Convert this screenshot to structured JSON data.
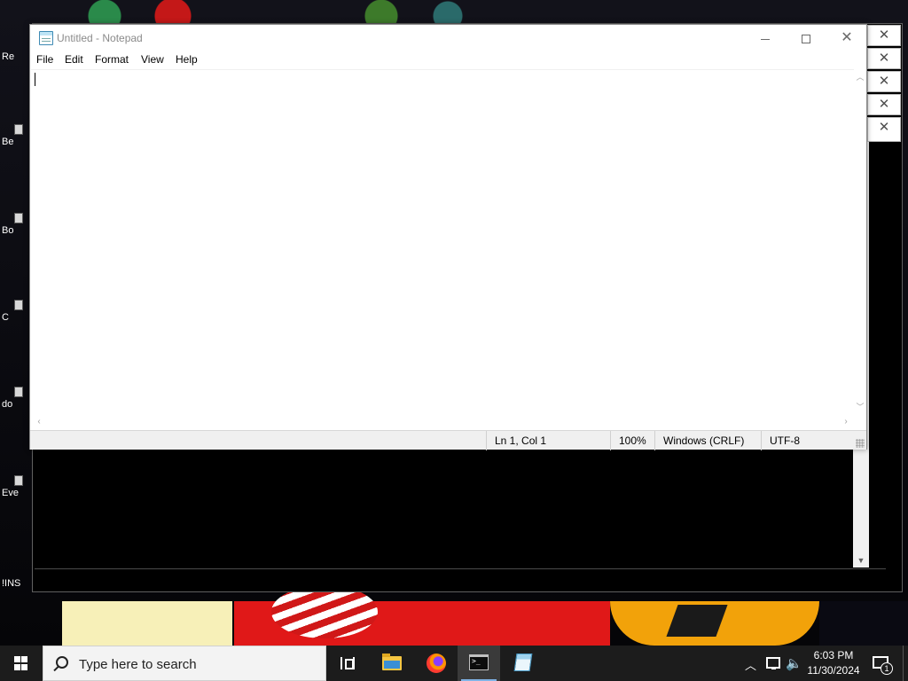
{
  "notepad": {
    "title": "Untitled - Notepad",
    "menu": [
      "File",
      "Edit",
      "Format",
      "View",
      "Help"
    ],
    "content": "",
    "status": {
      "position": "Ln 1, Col 1",
      "zoom": "100%",
      "line_ending": "Windows (CRLF)",
      "encoding": "UTF-8"
    }
  },
  "desktop": {
    "icons": [
      "Re",
      "Be",
      "Bo",
      "C",
      "do",
      "Eve",
      "!INS"
    ]
  },
  "taskbar": {
    "search_placeholder": "Type here to search",
    "apps": [
      "task-view",
      "file-explorer",
      "firefox",
      "command-prompt",
      "notepad"
    ],
    "active_app": "command-prompt",
    "clock_time": "6:03 PM",
    "clock_date": "11/30/2024",
    "notification_count": "1"
  },
  "colors": {
    "taskbar_bg": "#1c1c1c",
    "notepad_bg": "#ffffff",
    "statusbar_bg": "#f0f0f0",
    "active_indicator": "#7fb3e6"
  }
}
